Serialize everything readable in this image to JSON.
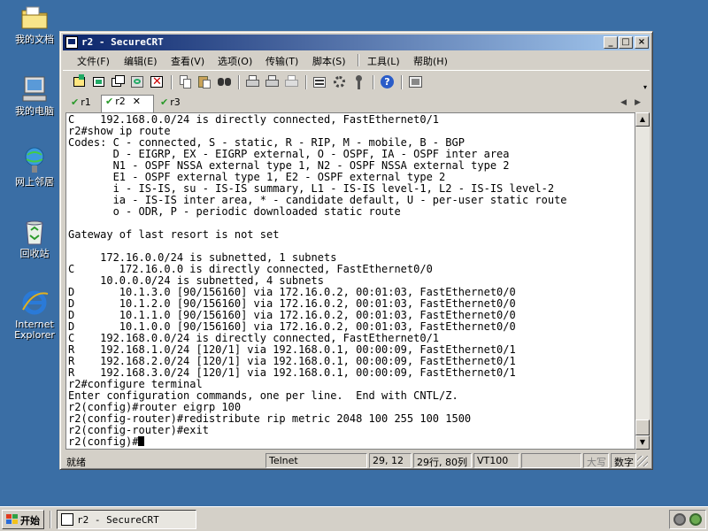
{
  "desktop": {
    "icons": [
      {
        "label": "我的文档"
      },
      {
        "label": "我的电脑"
      },
      {
        "label": "网上邻居"
      },
      {
        "label": "回收站"
      },
      {
        "label": "Internet Explorer"
      }
    ]
  },
  "window": {
    "title": "r2 - SecureCRT",
    "controls": {
      "minimize": "_",
      "maximize": "□",
      "close": "×"
    }
  },
  "menu": [
    "文件(F)",
    "编辑(E)",
    "查看(V)",
    "选项(O)",
    "传输(T)",
    "脚本(S)",
    "工具(L)",
    "帮助(H)"
  ],
  "toolbar_icons": [
    "connect-icon",
    "quick-connect-icon",
    "tab-icon",
    "reconnect-icon",
    "disconnect-icon",
    "copy-icon",
    "paste-icon",
    "find-icon",
    "print-icon",
    "print-setup-icon",
    "print-screen-icon",
    "session-options-icon",
    "global-options-icon",
    "keymap-icon",
    "help-icon",
    "sftp-icon"
  ],
  "tabs": [
    {
      "label": "r1",
      "active": false
    },
    {
      "label": "r2",
      "active": true
    },
    {
      "label": "r3",
      "active": false
    }
  ],
  "terminal": {
    "lines": [
      "C    192.168.0.0/24 is directly connected, FastEthernet0/1",
      "r2#show ip route",
      "Codes: C - connected, S - static, R - RIP, M - mobile, B - BGP",
      "       D - EIGRP, EX - EIGRP external, O - OSPF, IA - OSPF inter area",
      "       N1 - OSPF NSSA external type 1, N2 - OSPF NSSA external type 2",
      "       E1 - OSPF external type 1, E2 - OSPF external type 2",
      "       i - IS-IS, su - IS-IS summary, L1 - IS-IS level-1, L2 - IS-IS level-2",
      "       ia - IS-IS inter area, * - candidate default, U - per-user static route",
      "       o - ODR, P - periodic downloaded static route",
      "",
      "Gateway of last resort is not set",
      "",
      "     172.16.0.0/24 is subnetted, 1 subnets",
      "C       172.16.0.0 is directly connected, FastEthernet0/0",
      "     10.0.0.0/24 is subnetted, 4 subnets",
      "D       10.1.3.0 [90/156160] via 172.16.0.2, 00:01:03, FastEthernet0/0",
      "D       10.1.2.0 [90/156160] via 172.16.0.2, 00:01:03, FastEthernet0/0",
      "D       10.1.1.0 [90/156160] via 172.16.0.2, 00:01:03, FastEthernet0/0",
      "D       10.1.0.0 [90/156160] via 172.16.0.2, 00:01:03, FastEthernet0/0",
      "C    192.168.0.0/24 is directly connected, FastEthernet0/1",
      "R    192.168.1.0/24 [120/1] via 192.168.0.1, 00:00:09, FastEthernet0/1",
      "R    192.168.2.0/24 [120/1] via 192.168.0.1, 00:00:09, FastEthernet0/1",
      "R    192.168.3.0/24 [120/1] via 192.168.0.1, 00:00:09, FastEthernet0/1",
      "r2#configure terminal",
      "Enter configuration commands, one per line.  End with CNTL/Z.",
      "r2(config)#router eigrp 100",
      "r2(config-router)#redistribute rip metric 2048 100 255 100 1500",
      "r2(config-router)#exit"
    ],
    "prompt": "r2(config)#"
  },
  "status": {
    "ready": "就绪",
    "protocol": "Telnet",
    "position": "29, 12",
    "size": "29行, 80列",
    "emulation": "VT100",
    "caps": "大写",
    "num": "数字"
  },
  "taskbar": {
    "start": "开始",
    "task": "r2 - SecureCRT"
  },
  "colors": {
    "desktop": "#3a6ea5",
    "titlebar_start": "#0a246a",
    "titlebar_end": "#a6caf0",
    "chrome": "#d4d0c8"
  }
}
